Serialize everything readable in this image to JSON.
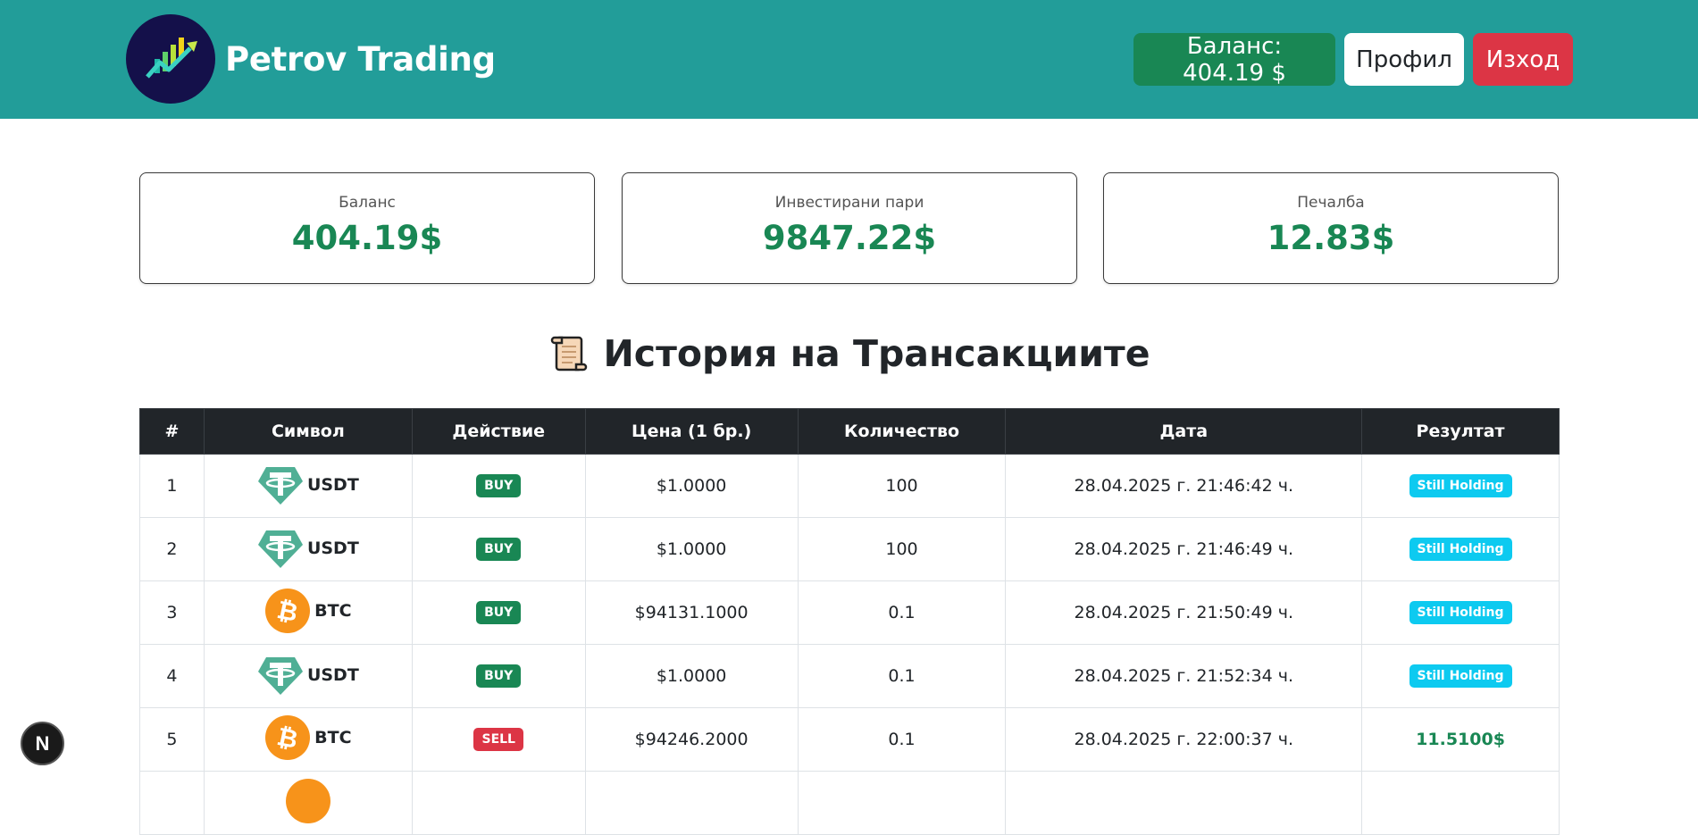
{
  "header": {
    "brand_name": "Petrov Trading",
    "balance_button": "Баланс: 404.19 $",
    "profile_button": "Профил",
    "logout_button": "Изход"
  },
  "stats": [
    {
      "label": "Баланс",
      "value": "404.19$"
    },
    {
      "label": "Инвестирани пари",
      "value": "9847.22$"
    },
    {
      "label": "Печалба",
      "value": "12.83$"
    }
  ],
  "section_title": "История на Трансакциите",
  "table": {
    "columns": [
      "#",
      "Символ",
      "Действие",
      "Цена (1 бр.)",
      "Количество",
      "Дата",
      "Резултат"
    ],
    "rows": [
      {
        "num": "1",
        "symbol": "USDT",
        "icon": "tether-icon",
        "action": "BUY",
        "price": "$1.0000",
        "qty": "100",
        "date": "28.04.2025 г. 21:46:42 ч.",
        "result": "Still Holding"
      },
      {
        "num": "2",
        "symbol": "USDT",
        "icon": "tether-icon",
        "action": "BUY",
        "price": "$1.0000",
        "qty": "100",
        "date": "28.04.2025 г. 21:46:49 ч.",
        "result": "Still Holding"
      },
      {
        "num": "3",
        "symbol": "BTC",
        "icon": "bitcoin-icon",
        "action": "BUY",
        "price": "$94131.1000",
        "qty": "0.1",
        "date": "28.04.2025 г. 21:50:49 ч.",
        "result": "Still Holding"
      },
      {
        "num": "4",
        "symbol": "USDT",
        "icon": "tether-icon",
        "action": "BUY",
        "price": "$1.0000",
        "qty": "0.1",
        "date": "28.04.2025 г. 21:52:34 ч.",
        "result": "Still Holding"
      },
      {
        "num": "5",
        "symbol": "BTC",
        "icon": "bitcoin-icon",
        "action": "SELL",
        "price": "$94246.2000",
        "qty": "0.1",
        "date": "28.04.2025 г. 22:00:37 ч.",
        "result": "11.5100$"
      }
    ]
  },
  "floating_button": "N",
  "colors": {
    "header_bg": "#229d99",
    "success": "#198754",
    "danger": "#dc3545",
    "info": "#0dcaf0",
    "dark": "#212529"
  }
}
